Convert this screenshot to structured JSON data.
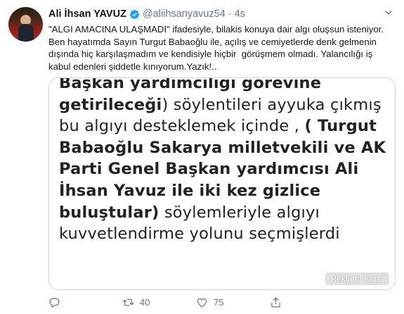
{
  "tweet": {
    "author_name": "Ali İhsan YAVUZ",
    "handle": "@aliihsanyavuz54",
    "separator": "·",
    "time": "4s",
    "text": "\"ALGI AMACINA ULAŞMADI\" ifadesiyle, bilakis konuya dair algı oluşsun isteniyor. Ben hayatımda Sayın Turgut Babaoğlu ile, açılış ve cemiyetlerde denk gelmenin dışında hiç karşılaşmadım ve kendisiyle hiçbir  görüşmem olmadı. Yalancılığı iş kabul edenleri şiddetle kınıyorum.Yazık!..",
    "media": {
      "line1": "Başkan yardımcılığı görevine",
      "line2_bold": "getirileceği",
      "line2_rest": ") söylentileri ayyuka çıkmış",
      "line3_rest": "bu algıyı desteklemek içinde , ",
      "line3_bold": "( Turgut",
      "line4_bold": "Babaoğlu Sakarya milletvekili  ve AK",
      "line5_bold": "Parti Genel Başkan yardımcısı Ali",
      "line6_bold": "İhsan Yavuz ile iki kez gizlice",
      "line7_bold": "buluştular)",
      "line7_rest": "  söylemleriyle algıyı",
      "line8": "kuvvetlendirme yolunu seçmişlerdi",
      "tag": "Reklamı Kapa"
    },
    "actions": {
      "reply_count": "",
      "retweet_count": "40",
      "like_count": "75",
      "share_count": ""
    }
  },
  "colors": {
    "text": "#14171a",
    "secondary": "#657786",
    "verified": "#1da1f2",
    "border": "#ccd6dd"
  },
  "icons": [
    "verified-badge-icon",
    "chevron-down-icon",
    "reply-icon",
    "retweet-icon",
    "like-icon",
    "share-icon"
  ]
}
